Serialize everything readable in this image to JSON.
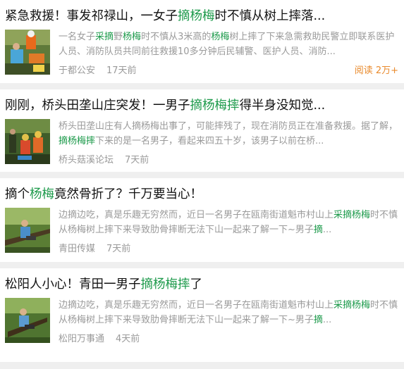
{
  "articles": [
    {
      "title_parts": [
        "紧急救援！事发祁禄山，一女子",
        "摘杨梅",
        "时不慎从树上摔落..."
      ],
      "summary_parts": [
        "一名女子",
        "采摘",
        "野",
        "杨梅",
        "时不慎从3米高的",
        "杨梅",
        "树上摔了下来急需救助民警立即联系医护人员、消防队员共同前往救援10多分钟后民辅警、医护人员、消防..."
      ],
      "source": "于都公安",
      "time": "17天前",
      "reads": "阅读 2万+"
    },
    {
      "title_parts": [
        "刚刚，桥头田垄山庄突发！一男子",
        "摘杨梅摔",
        "得半身没知觉..."
      ],
      "summary_parts": [
        "桥头田垄山庄有人摘杨梅出事了，可能摔残了，现在消防员正在准备救援。据了解，",
        "摘杨梅摔",
        "下来的是一名男子，看起来四五十岁，该男子以前在桥..."
      ],
      "source": "桥头菇溪论坛",
      "time": "7天前"
    },
    {
      "title_parts": [
        "摘个",
        "杨梅",
        "竟然骨折了？千万要当心！"
      ],
      "summary_parts": [
        "边摘边吃，真是乐趣无穷然而，近日一名男子在瓯南街道魁市村山上",
        "采摘杨梅",
        "时不慎从杨梅树上摔下来导致肋骨摔断无法下山一起来了解一下~男子",
        "摘",
        "..."
      ],
      "source": "青田传媒",
      "time": "7天前"
    },
    {
      "title_parts": [
        "松阳人小心！青田一男子",
        "摘杨梅摔",
        "了"
      ],
      "summary_parts": [
        "边摘边吃，真是乐趣无穷然而，近日一名男子在瓯南街道魁市村山上",
        "采摘杨梅",
        "时不慎从杨梅树上摔下来导致肋骨摔断无法下山一起来了解一下~男子",
        "摘",
        "..."
      ],
      "source": "松阳万事通",
      "time": "4天前"
    }
  ],
  "colors": {
    "highlight": "#1d9a4b",
    "reads": "#e98a2c",
    "meta": "#9a9a9a"
  },
  "icons": [
    "rescue-photo",
    "forest-rescue-photo",
    "tree-climbing-photo",
    "tree-climbing-photo"
  ]
}
